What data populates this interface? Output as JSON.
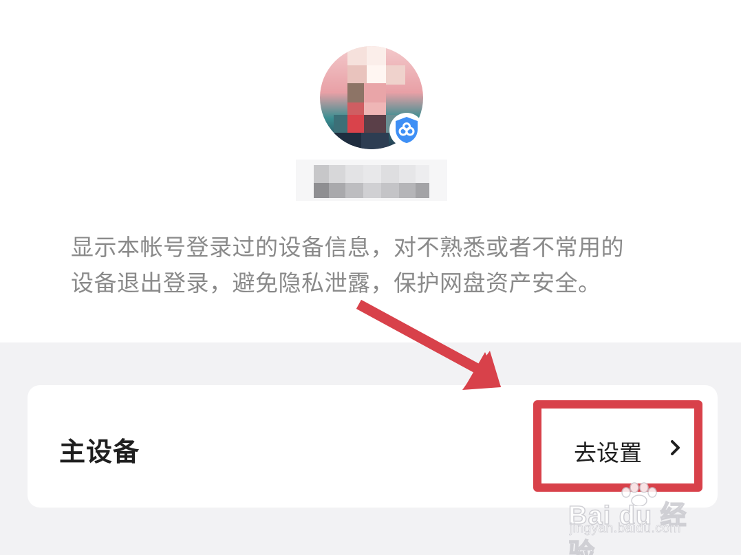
{
  "profile": {
    "avatar_icon": "user-avatar-pixelated",
    "badge_icon": "cloud-shield-icon",
    "username": "",
    "badge_color": "#3e8ff5"
  },
  "description": {
    "line1": "显示本帐号登录过的设备信息，对不熟悉或者不常用的",
    "line2": "设备退出登录，避免隐私泄露，保护网盘资产安全。"
  },
  "main_device": {
    "title": "主设备",
    "action_label": "去设置",
    "chevron_icon": "chevron-right-icon"
  },
  "annotation": {
    "highlight_color": "#d8414a",
    "arrow_color": "#d8414a"
  },
  "watermark": {
    "logo": "Bai du 经验",
    "url": "jingyan.baidu.com"
  }
}
